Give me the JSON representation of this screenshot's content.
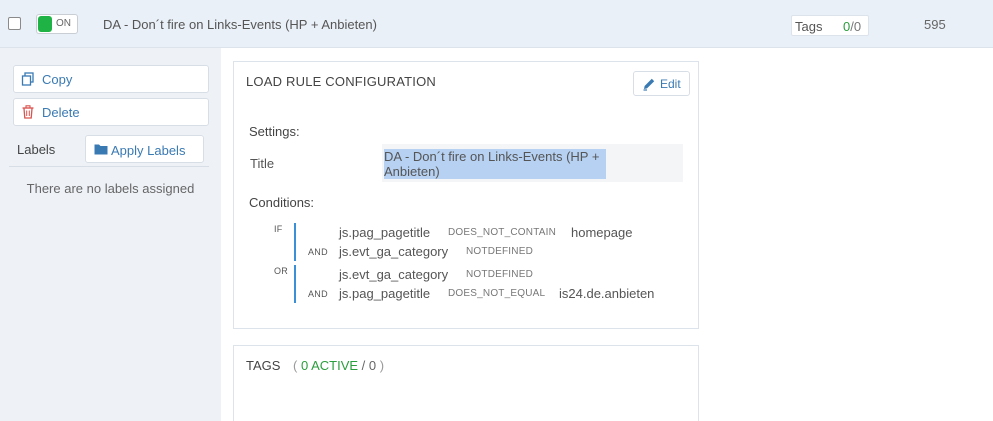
{
  "header": {
    "toggle_label": "ON",
    "rule_name": "DA - Don´t fire on Links-Events (HP + Anbieten)",
    "tags_label": "Tags",
    "tags_active": "0",
    "tags_sep": "/",
    "tags_total": "0",
    "row_id": "595"
  },
  "sidebar": {
    "copy_label": "Copy",
    "delete_label": "Delete",
    "labels_heading": "Labels",
    "apply_labels_label": "Apply Labels",
    "no_labels_text": "There are no labels assigned"
  },
  "config": {
    "title": "LOAD RULE CONFIGURATION",
    "edit_label": "Edit",
    "settings_heading": "Settings:",
    "title_label": "Title",
    "title_value": "DA - Don´t fire on Links-Events (HP + Anbieten)",
    "conditions_heading": "Conditions:",
    "conditions": [
      {
        "group_op": "IF",
        "rows": [
          {
            "join": "",
            "variable": "js.pag_pagetitle",
            "operator": "DOES_NOT_CONTAIN",
            "value": "homepage"
          },
          {
            "join": "AND",
            "variable": "js.evt_ga_category",
            "operator": "NOTDEFINED",
            "value": ""
          }
        ]
      },
      {
        "group_op": "OR",
        "rows": [
          {
            "join": "",
            "variable": "js.evt_ga_category",
            "operator": "NOTDEFINED",
            "value": ""
          },
          {
            "join": "AND",
            "variable": "js.pag_pagetitle",
            "operator": "DOES_NOT_EQUAL",
            "value": "is24.de.anbieten"
          }
        ]
      }
    ]
  },
  "tags_panel": {
    "title": "TAGS",
    "open_paren": "(",
    "active_text": "0 ACTIVE",
    "slash": "/",
    "total_text": "0",
    "close_paren": ")"
  },
  "colors": {
    "accent": "#3a7ab3",
    "toggle_on": "#1fb346",
    "active_green": "#2a9d3c",
    "condition_bar": "#3b8fd6",
    "selection": "#b6d1f2",
    "delete_icon": "#d9534f"
  }
}
